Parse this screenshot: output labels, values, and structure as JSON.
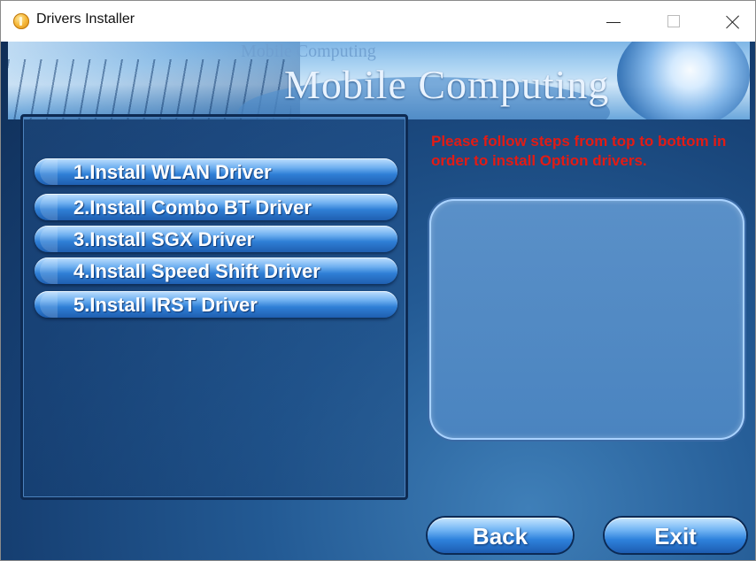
{
  "window": {
    "title": "Drivers Installer",
    "controls": {
      "minimize": "minimize",
      "maximize": "maximize",
      "close": "close"
    }
  },
  "banner": {
    "watermark_text": "Mobile Computing",
    "title_text": "Mobile Computing"
  },
  "driver_buttons": [
    {
      "label": "1.Install WLAN Driver"
    },
    {
      "label": "2.Install Combo BT Driver"
    },
    {
      "label": "3.Install SGX Driver"
    },
    {
      "label": "4.Install Speed Shift Driver"
    },
    {
      "label": "5.Install IRST Driver"
    }
  ],
  "instructions": "Please follow steps from top to bottom in order to install Option drivers.",
  "actions": {
    "back": "Back",
    "exit": "Exit"
  },
  "colors": {
    "instruction_text": "#e31b14",
    "background": "#1b4a80",
    "button_accent": "#2e82dc"
  }
}
